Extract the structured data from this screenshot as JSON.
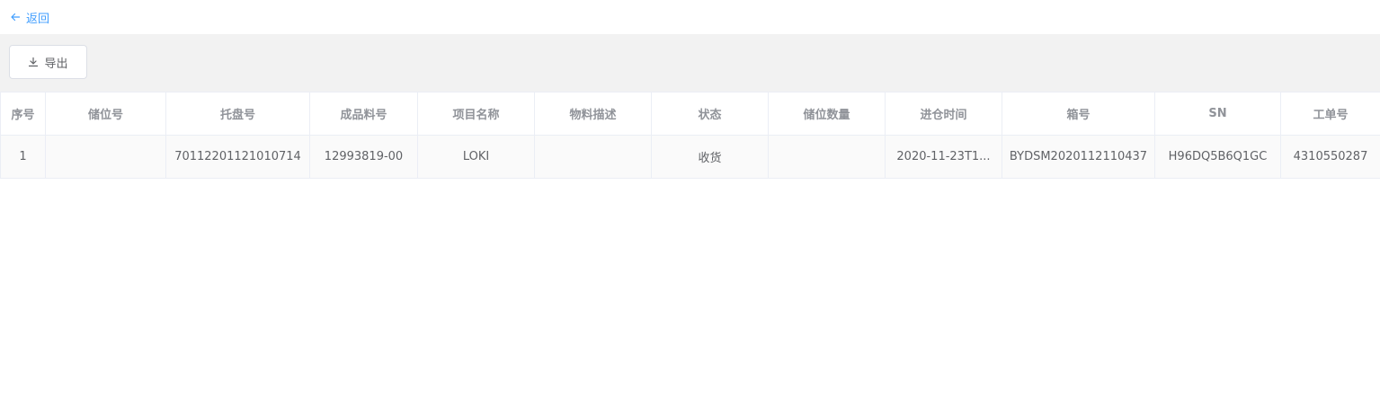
{
  "nav": {
    "back_label": "返回"
  },
  "toolbar": {
    "export_label": "导出"
  },
  "table": {
    "columns": [
      "序号",
      "储位号",
      "托盘号",
      "成品料号",
      "项目名称",
      "物料描述",
      "状态",
      "储位数量",
      "进仓时间",
      "箱号",
      "SN",
      "工单号"
    ],
    "rows": [
      [
        "1",
        "",
        "70112201121010714",
        "12993819-00",
        "LOKI",
        "",
        "收货",
        "",
        "2020-11-23T1...",
        "BYDSM2020112110437",
        "H96DQ5B6Q1GC",
        "4310550287"
      ]
    ]
  },
  "colors": {
    "accent": "#409eff",
    "toolbar_bg": "#f2f2f2",
    "border": "#ebeef5",
    "header_text": "#909399",
    "cell_text": "#606266"
  },
  "icons": {
    "back": "arrow-left-icon",
    "export": "download-icon"
  }
}
